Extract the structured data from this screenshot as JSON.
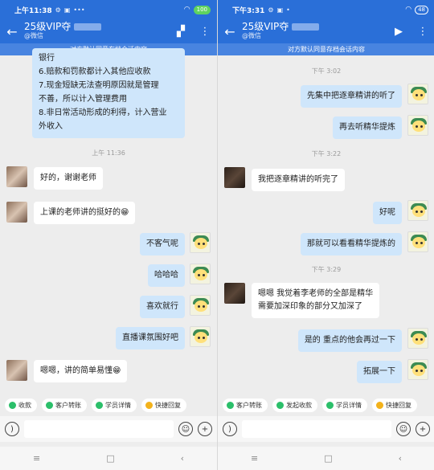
{
  "left": {
    "status": {
      "time": "上午11:38",
      "battery": "100"
    },
    "title": {
      "name": "25级VIP夺",
      "subtitle": "@微信"
    },
    "banner": "对方默认同意存档会话内容",
    "messages": {
      "m0": "银行",
      "m1": "6.赔款和罚款都计入其他应收款",
      "m2": "7.现金短缺无法查明原因就是管理",
      "m3": "不善，所以计入管理费用",
      "m4": "8.非日常活动形成的利得，计入营业",
      "m5": "外收入",
      "ts1": "上午 11:36",
      "m6": "好的，谢谢老师",
      "m7": "上课的老师讲的挺好的😁",
      "m8": "不客气呢",
      "m9": "哈哈哈",
      "m10": "喜欢就行",
      "m11": "直播课氛围好吧",
      "m12": "嗯嗯，讲的简单易懂😁"
    },
    "quick": [
      "收款",
      "客户转账",
      "学员详情",
      "快捷回复"
    ]
  },
  "right": {
    "status": {
      "time": "下午3:31",
      "battery": "48"
    },
    "title": {
      "name": "25级VIP夺",
      "subtitle": "@微信"
    },
    "banner": "对方默认同意存档会话内容",
    "messages": {
      "ts1": "下午 3:02",
      "m1": "先集中把逐章精讲的听了",
      "m2": "再去听精华提炼",
      "ts2": "下午 3:22",
      "m3": "我把逐章精讲的听完了",
      "m4": "好呢",
      "m5": "那就可以看看精华提炼的",
      "ts3": "下午 3:29",
      "m6a": "嗯嗯 我觉着李老师的全部是精华",
      "m6b": "需要加深印象的部分又加深了",
      "m7": "是的 重点的他会再过一下",
      "m8": "拓展一下"
    },
    "quick": [
      "客户转账",
      "发起收款",
      "学员详情",
      "快捷回复"
    ]
  },
  "colors": {
    "header": "#2a6fd8",
    "banner": "#4884e0",
    "my_bubble": "#cfe6fb",
    "their_bubble": "#ffffff"
  },
  "icons": [
    "back-arrow-icon",
    "more-icon",
    "video-call-icon",
    "voice-icon",
    "emoji-icon",
    "plus-icon",
    "menu-icon",
    "home-icon",
    "back-nav-icon"
  ]
}
